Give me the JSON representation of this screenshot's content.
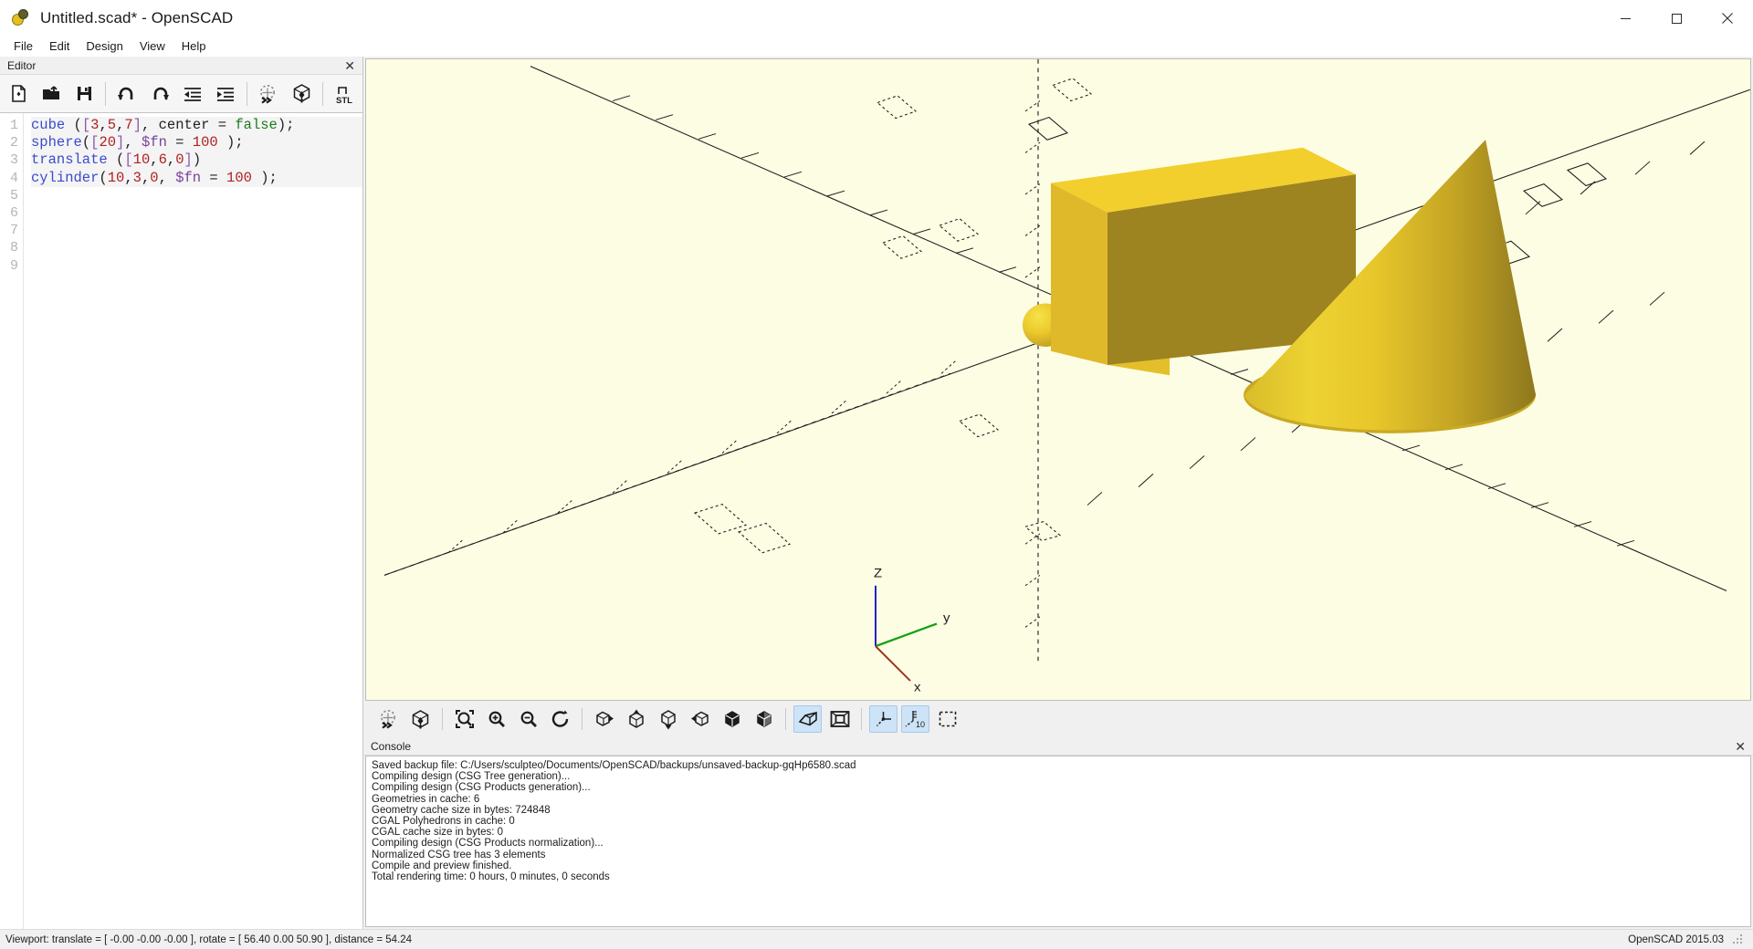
{
  "window": {
    "title": "Untitled.scad* - OpenSCAD",
    "app_icon": "openscad-logo-icon",
    "minimize_label": "─",
    "maximize_label": "☐",
    "close_label": "✕"
  },
  "menubar": {
    "items": [
      {
        "label": "File"
      },
      {
        "label": "Edit"
      },
      {
        "label": "Design"
      },
      {
        "label": "View"
      },
      {
        "label": "Help"
      }
    ]
  },
  "editor": {
    "dock_title": "Editor",
    "close_label": "✕",
    "toolbar": [
      {
        "name": "new-file-button",
        "tip": "New"
      },
      {
        "name": "open-file-button",
        "tip": "Open"
      },
      {
        "name": "save-file-button",
        "tip": "Save"
      },
      {
        "name": "undo-button",
        "tip": "Undo"
      },
      {
        "name": "redo-button",
        "tip": "Redo"
      },
      {
        "name": "unindent-button",
        "tip": "Unindent"
      },
      {
        "name": "indent-button",
        "tip": "Indent"
      },
      {
        "name": "preview-button",
        "tip": "Preview"
      },
      {
        "name": "render-button",
        "tip": "Render"
      },
      {
        "name": "export-stl-button",
        "tip": "Export as STL"
      }
    ],
    "stl_label": "STL",
    "line_numbers": [
      "1",
      "2",
      "3",
      "4",
      "5",
      "6",
      "7",
      "8",
      "9"
    ],
    "code_lines": [
      "cube ([3,5,7], center = false);",
      "sphere([20], $fn = 100);",
      "translate ([10,6,0])",
      "cylinder(10,3,0, $fn = 100);"
    ],
    "code_tokens": [
      [
        {
          "t": "cube",
          "c": "tok-fn"
        },
        {
          "t": " (",
          "c": "tok-pun"
        },
        {
          "t": "[",
          "c": "tok-brk"
        },
        {
          "t": "3",
          "c": "tok-num"
        },
        {
          "t": ",",
          "c": "tok-pun"
        },
        {
          "t": "5",
          "c": "tok-num"
        },
        {
          "t": ",",
          "c": "tok-pun"
        },
        {
          "t": "7",
          "c": "tok-num"
        },
        {
          "t": "]",
          "c": "tok-brk"
        },
        {
          "t": ", center = ",
          "c": "tok-pun"
        },
        {
          "t": "false",
          "c": "tok-kw"
        },
        {
          "t": ")",
          "c": "tok-pun"
        },
        {
          "t": ";",
          "c": "tok-pun"
        }
      ],
      [
        {
          "t": "sphere",
          "c": "tok-fn"
        },
        {
          "t": "(",
          "c": "tok-pun"
        },
        {
          "t": "[",
          "c": "tok-brk"
        },
        {
          "t": "20",
          "c": "tok-num"
        },
        {
          "t": "]",
          "c": "tok-brk"
        },
        {
          "t": ", ",
          "c": "tok-pun"
        },
        {
          "t": "$fn",
          "c": "tok-var"
        },
        {
          "t": " = ",
          "c": "tok-pun"
        },
        {
          "t": "100",
          "c": "tok-num"
        },
        {
          "t": " );",
          "c": "tok-pun"
        }
      ],
      [
        {
          "t": "translate",
          "c": "tok-fn"
        },
        {
          "t": " (",
          "c": "tok-pun"
        },
        {
          "t": "[",
          "c": "tok-brk"
        },
        {
          "t": "10",
          "c": "tok-num"
        },
        {
          "t": ",",
          "c": "tok-pun"
        },
        {
          "t": "6",
          "c": "tok-num"
        },
        {
          "t": ",",
          "c": "tok-pun"
        },
        {
          "t": "0",
          "c": "tok-num"
        },
        {
          "t": "]",
          "c": "tok-brk"
        },
        {
          "t": ")",
          "c": "tok-pun"
        }
      ],
      [
        {
          "t": "cylinder",
          "c": "tok-fn"
        },
        {
          "t": "(",
          "c": "tok-pun"
        },
        {
          "t": "10",
          "c": "tok-num"
        },
        {
          "t": ",",
          "c": "tok-pun"
        },
        {
          "t": "3",
          "c": "tok-num"
        },
        {
          "t": ",",
          "c": "tok-pun"
        },
        {
          "t": "0",
          "c": "tok-num"
        },
        {
          "t": ", ",
          "c": "tok-pun"
        },
        {
          "t": "$fn",
          "c": "tok-var"
        },
        {
          "t": " = ",
          "c": "tok-pun"
        },
        {
          "t": "100",
          "c": "tok-num"
        },
        {
          "t": " );",
          "c": "tok-pun"
        }
      ]
    ]
  },
  "viewport": {
    "background_color": "#fdfde4",
    "object_color": "#e8c72b",
    "axis_labels": {
      "x": "x",
      "y": "y",
      "z": "Z"
    },
    "axis_colors": {
      "x": "#a03020",
      "y": "#12a012",
      "z": "#2222c8"
    },
    "scale_tick_label": "10",
    "objects": [
      {
        "name": "cube-object",
        "shape": "box"
      },
      {
        "name": "sphere-object",
        "shape": "sphere"
      },
      {
        "name": "cone-object",
        "shape": "cone"
      }
    ]
  },
  "view_toolbar": {
    "buttons": [
      {
        "name": "preview-button",
        "active": false
      },
      {
        "name": "render-button",
        "active": false
      },
      {
        "name": "zoom-all-button",
        "active": false
      },
      {
        "name": "zoom-in-button",
        "active": false
      },
      {
        "name": "zoom-out-button",
        "active": false
      },
      {
        "name": "reset-view-button",
        "active": false
      },
      {
        "name": "view-right-button",
        "active": false
      },
      {
        "name": "view-top-button",
        "active": false
      },
      {
        "name": "view-bottom-button",
        "active": false
      },
      {
        "name": "view-left-button",
        "active": false
      },
      {
        "name": "view-front-button",
        "active": false
      },
      {
        "name": "view-back-button",
        "active": false
      },
      {
        "name": "perspective-button",
        "active": true
      },
      {
        "name": "orthogonal-button",
        "active": false
      },
      {
        "name": "show-axes-button",
        "active": true
      },
      {
        "name": "show-scale-markers-button",
        "active": true
      },
      {
        "name": "show-crosshairs-button",
        "active": false
      }
    ],
    "scale_marker_label": "10"
  },
  "console": {
    "dock_title": "Console",
    "close_label": "✕",
    "lines": [
      "Saved backup file: C:/Users/sculpteo/Documents/OpenSCAD/backups/unsaved-backup-gqHp6580.scad",
      "Compiling design (CSG Tree generation)...",
      "Compiling design (CSG Products generation)...",
      "Geometries in cache: 6",
      "Geometry cache size in bytes: 724848",
      "CGAL Polyhedrons in cache: 0",
      "CGAL cache size in bytes: 0",
      "Compiling design (CSG Products normalization)...",
      "Normalized CSG tree has 3 elements",
      "Compile and preview finished.",
      "Total rendering time: 0 hours, 0 minutes, 0 seconds"
    ]
  },
  "statusbar": {
    "viewport_info": "Viewport: translate = [ -0.00 -0.00 -0.00 ], rotate = [ 56.40 0.00 50.90 ], distance = 54.24",
    "version": "OpenSCAD 2015.03"
  }
}
